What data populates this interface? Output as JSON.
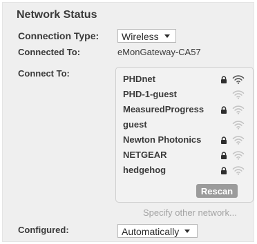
{
  "panel": {
    "title": "Network Status"
  },
  "connection_type": {
    "label": "Connection Type:",
    "selected": "Wireless"
  },
  "connected_to": {
    "label": "Connected To:",
    "value": "eMonGateway-CA57"
  },
  "connect_to": {
    "label": "Connect To:",
    "networks": [
      {
        "name": "PHDnet",
        "secured": true,
        "signal": "strong"
      },
      {
        "name": "PHD-1-guest",
        "secured": false,
        "signal": "weak"
      },
      {
        "name": "MeasuredProgress",
        "secured": true,
        "signal": "weak"
      },
      {
        "name": "guest",
        "secured": false,
        "signal": "weak"
      },
      {
        "name": "Newton Photonics",
        "secured": true,
        "signal": "weak"
      },
      {
        "name": "NETGEAR",
        "secured": true,
        "signal": "weak"
      },
      {
        "name": "hedgehog",
        "secured": true,
        "signal": "weak"
      }
    ],
    "rescan_label": "Rescan",
    "other_network_label": "Specify other network..."
  },
  "configured": {
    "label": "Configured:",
    "selected": "Automatically"
  },
  "colors": {
    "panel_bg": "#efefef",
    "text": "#3a3a3a",
    "button_bg": "#9b9b9b",
    "muted_text": "#a3a3a3",
    "icon_strong": "#555555",
    "icon_weak": "#c4c4c4"
  },
  "icons": {
    "lock": "lock-icon",
    "wifi": "wifi-signal-icon",
    "dropdown": "chevron-down-icon"
  }
}
